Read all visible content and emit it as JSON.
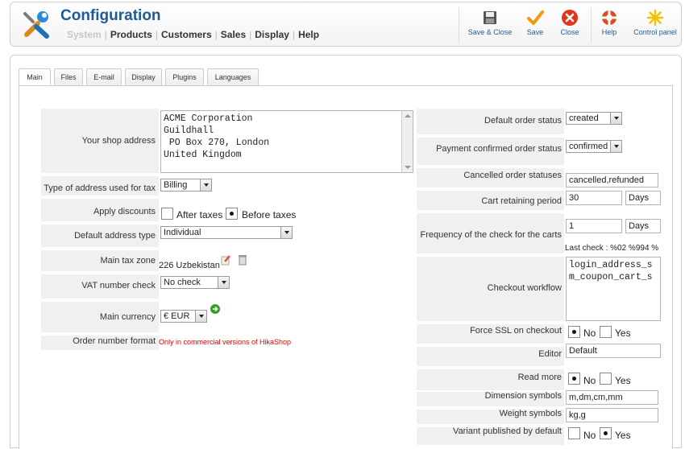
{
  "app": {
    "title": "Configuration"
  },
  "nav": {
    "items": [
      "System",
      "Products",
      "Customers",
      "Sales",
      "Display",
      "Help"
    ]
  },
  "toolbar": {
    "save_close": "Save & Close",
    "save": "Save",
    "close": "Close",
    "help": "Help",
    "control_panel": "Control panel"
  },
  "tabs": [
    "Main",
    "Files",
    "E-mail",
    "Display",
    "Plugins",
    "Languages"
  ],
  "left": {
    "shop_address_label": "Your shop address",
    "shop_address_value": "ACME Corporation\nGuildhall\n PO Box 270, London\nUnited Kingdom",
    "tax_address_label": "Type of address used for tax",
    "tax_address_value": "Billing",
    "apply_discounts_label": "Apply discounts",
    "after_taxes": "After taxes",
    "before_taxes": "Before taxes",
    "default_address_type_label": "Default address type",
    "default_address_type_value": "Individual",
    "main_tax_zone_label": "Main tax zone",
    "main_tax_zone_value": "226 Uzbekistan",
    "vat_check_label": "VAT number check",
    "vat_check_value": "No check",
    "main_currency_label": "Main currency",
    "main_currency_value": "€ EUR",
    "order_number_label": "Order number format",
    "order_number_value": "Only in commercial versions of HikaShop"
  },
  "right": {
    "default_order_status_label": "Default order status",
    "default_order_status_value": "created",
    "payment_confirmed_label": "Payment confirmed order status",
    "payment_confirmed_value": "confirmed",
    "cancelled_statuses_label": "Cancelled order statuses",
    "cancelled_statuses_value": "cancelled,refunded",
    "cart_retaining_label": "Cart retaining period",
    "cart_retaining_value": "30",
    "cart_retaining_unit": "Days",
    "frequency_label": "Frequency of the check for the carts",
    "frequency_value": "1",
    "frequency_unit": "Days",
    "last_check": "Last check : %02 %994 %",
    "checkout_workflow_label": "Checkout workflow",
    "checkout_workflow_value": "login_address_s\nm_coupon_cart_s",
    "force_ssl_label": "Force SSL on checkout",
    "no": "No",
    "yes": "Yes",
    "editor_label": "Editor",
    "editor_value": "Default",
    "read_more_label": "Read more",
    "dimension_label": "Dimension symbols",
    "dimension_value": "m,dm,cm,mm",
    "weight_label": "Weight symbols",
    "weight_value": "kg,g",
    "variant_label": "Variant published by default"
  },
  "colors": {
    "title": "#1f5a96",
    "red_note": "#e00000",
    "row_bg": "#f0f0f0"
  }
}
